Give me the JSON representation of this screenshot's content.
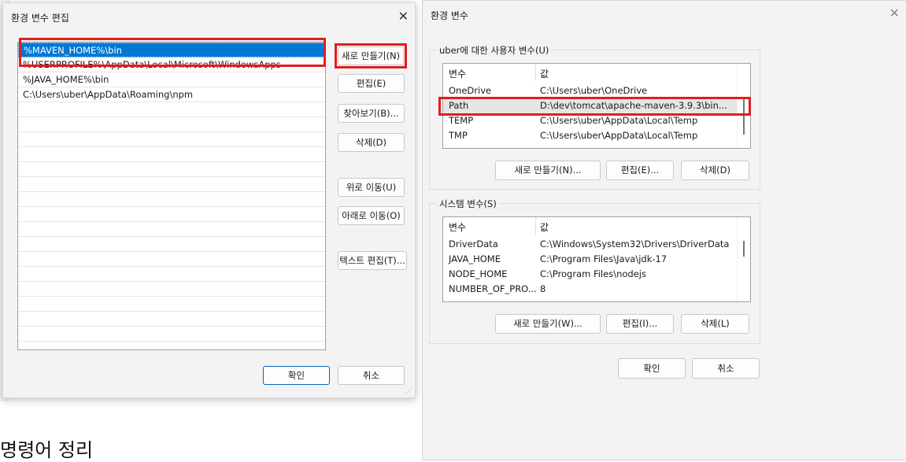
{
  "background": {
    "heading": "명령어 정리"
  },
  "edit_dialog": {
    "title": "환경 변수 편집",
    "entries": [
      "%MAVEN_HOME%\\bin",
      "%USERPROFILE%\\AppData\\Local\\Microsoft\\WindowsApps",
      "%JAVA_HOME%\\bin",
      "C:\\Users\\uber\\AppData\\Roaming\\npm"
    ],
    "buttons": {
      "new": "새로 만들기(N)",
      "edit": "편집(E)",
      "browse": "찾아보기(B)...",
      "delete": "삭제(D)",
      "move_up": "위로 이동(U)",
      "move_down": "아래로 이동(O)",
      "edit_text": "텍스트 편집(T)...",
      "ok": "확인",
      "cancel": "취소"
    }
  },
  "env_dialog": {
    "title": "환경 변수",
    "user_section": {
      "label": "uber에 대한 사용자 변수(U)",
      "columns": [
        "변수",
        "값"
      ],
      "rows": [
        {
          "name": "OneDrive",
          "value": "C:\\Users\\uber\\OneDrive"
        },
        {
          "name": "Path",
          "value": "D:\\dev\\tomcat\\apache-maven-3.9.3\\bin..."
        },
        {
          "name": "TEMP",
          "value": "C:\\Users\\uber\\AppData\\Local\\Temp"
        },
        {
          "name": "TMP",
          "value": "C:\\Users\\uber\\AppData\\Local\\Temp"
        }
      ],
      "buttons": {
        "new": "새로 만들기(N)...",
        "edit": "편집(E)...",
        "delete": "삭제(D)"
      }
    },
    "system_section": {
      "label": "시스템 변수(S)",
      "columns": [
        "변수",
        "값"
      ],
      "rows": [
        {
          "name": "DriverData",
          "value": "C:\\Windows\\System32\\Drivers\\DriverData"
        },
        {
          "name": "JAVA_HOME",
          "value": "C:\\Program Files\\Java\\jdk-17"
        },
        {
          "name": "NODE_HOME",
          "value": "C:\\Program Files\\nodejs"
        },
        {
          "name": "NUMBER_OF_PRO...",
          "value": "8"
        }
      ],
      "buttons": {
        "new": "새로 만들기(W)...",
        "edit": "편집(I)...",
        "delete": "삭제(L)"
      }
    },
    "buttons": {
      "ok": "확인",
      "cancel": "취소"
    }
  },
  "highlight_color": "#e01e1e",
  "accent_color": "#0078d4"
}
